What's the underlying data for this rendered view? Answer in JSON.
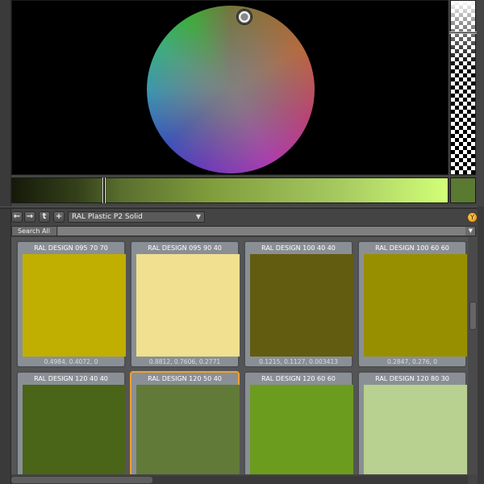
{
  "toolbar": {
    "back_label": "←",
    "forward_label": "→",
    "up_label": "t",
    "add_label": "+",
    "preset": "RAL Plastic P2 Solid",
    "dropdown_arrow": "▼",
    "filter_label": "Y"
  },
  "search": {
    "scope": "Search All",
    "value": "",
    "arrow": "▼"
  },
  "current_color": "#5a7a32",
  "swatches": [
    {
      "name": "RAL DESIGN 095 70 70",
      "values": "0.4984, 0.4072, 0",
      "color": "#c0ae00",
      "selected": false
    },
    {
      "name": "RAL DESIGN 095 90 40",
      "values": "0.8812, 0.7606, 0.2771",
      "color": "#f0e090",
      "selected": false
    },
    {
      "name": "RAL DESIGN 100 40 40",
      "values": "0.1215, 0.1127, 0.003413",
      "color": "#625c10",
      "selected": false
    },
    {
      "name": "RAL DESIGN 100 60 60",
      "values": "0.2847, 0.276, 0",
      "color": "#978f00",
      "selected": false
    },
    {
      "name": "RAL DESIGN 120 40 40",
      "values": "",
      "color": "#4a6418",
      "selected": false
    },
    {
      "name": "RAL DESIGN 120 50 40",
      "values": "",
      "color": "#627a38",
      "selected": true
    },
    {
      "name": "RAL DESIGN 120 60 60",
      "values": "",
      "color": "#6c9c1e",
      "selected": false
    },
    {
      "name": "RAL DESIGN 120 80 30",
      "values": "",
      "color": "#b8d090",
      "selected": false
    }
  ]
}
